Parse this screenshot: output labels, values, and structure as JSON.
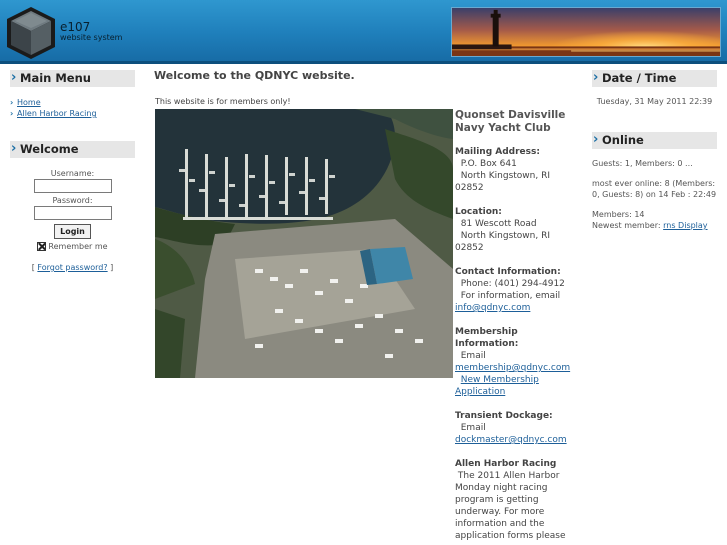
{
  "header": {
    "logo_name": "e107",
    "logo_sub": "website system"
  },
  "left": {
    "main_menu_title": "Main Menu",
    "menu_items": [
      {
        "label": "Home"
      },
      {
        "label": "Allen Harbor Racing"
      }
    ],
    "welcome_title": "Welcome",
    "username_label": "Username:",
    "password_label": "Password:",
    "login_label": "Login",
    "remember_label": "Remember me",
    "forgot_open": "[ ",
    "forgot_label": "Forgot password?",
    "forgot_close": " ]"
  },
  "main": {
    "title": "Welcome to the QDNYC website.",
    "members_only": "This website is for members only!"
  },
  "info": {
    "org": "Quonset Davisville Navy Yacht Club",
    "mailing_heading": "Mailing Address:",
    "mailing_1": "P.O. Box 641",
    "mailing_2": "North Kingstown, RI 02852",
    "location_heading": "Location:",
    "location_1": "81 Wescott Road",
    "location_2": "North Kingstown, RI 02852",
    "contact_heading": "Contact Information:",
    "contact_phone": "Phone: (401) 294-4912",
    "contact_info": "For information, email",
    "contact_email": "info@qdnyc.com",
    "membership_heading": "Membership Information:",
    "membership_email_label": "Email",
    "membership_email": "membership@qdnyc.com",
    "membership_app": "New Membership Application",
    "transient_heading": "Transient Dockage:",
    "transient_email_label": "Email",
    "transient_email": "dockmaster@qdnyc.com",
    "racing_heading": "Allen Harbor Racing",
    "racing_text": "The 2011 Allen Harbor Monday night racing program is getting underway.  For more information and the application forms please"
  },
  "right": {
    "datetime_title": "Date / Time",
    "datetime": "Tuesday, 31 May 2011 22:39",
    "online_title": "Online",
    "guests_members": "Guests: 1, Members: 0 ...",
    "most_ever": "most ever online: 8 (Members: 0, Guests: 8) on 14 Feb : 22:49",
    "members_count": "Members: 14",
    "newest_label": "Newest member: ",
    "newest_name": "rns Display"
  },
  "colors": {
    "header_blue": "#1f7fbb",
    "link": "#1d5f99",
    "caption_bg": "#e6e6e6"
  }
}
